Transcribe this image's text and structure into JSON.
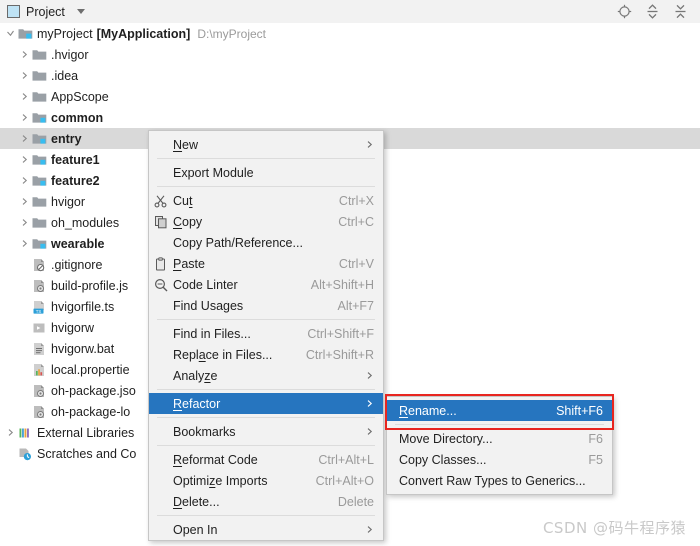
{
  "toolbar": {
    "title": "Project",
    "dropdown_icon": "chevron-down-icon",
    "actions": [
      {
        "name": "select-opened-file-icon",
        "label": "Select Opened File"
      },
      {
        "name": "expand-all-icon",
        "label": "Expand All"
      },
      {
        "name": "collapse-all-icon",
        "label": "Collapse All"
      }
    ]
  },
  "tree": {
    "root": {
      "name": "myProject",
      "module": "[MyApplication]",
      "path": "D:\\myProject",
      "icon": "project-folder-icon",
      "expanded": true
    },
    "items": [
      {
        "label": ".hvigor",
        "icon": "folder-icon",
        "arrow": true,
        "bold": false,
        "indent": 1
      },
      {
        "label": ".idea",
        "icon": "folder-icon",
        "arrow": true,
        "bold": false,
        "indent": 1
      },
      {
        "label": "AppScope",
        "icon": "folder-icon",
        "arrow": true,
        "bold": false,
        "indent": 1
      },
      {
        "label": "common",
        "icon": "module-folder-icon",
        "arrow": true,
        "bold": true,
        "indent": 1
      },
      {
        "label": "entry",
        "icon": "module-folder-icon",
        "arrow": true,
        "bold": true,
        "indent": 1,
        "selected": true
      },
      {
        "label": "feature1",
        "icon": "module-folder-icon",
        "arrow": true,
        "bold": true,
        "indent": 1
      },
      {
        "label": "feature2",
        "icon": "module-folder-icon",
        "arrow": true,
        "bold": true,
        "indent": 1
      },
      {
        "label": "hvigor",
        "icon": "folder-icon",
        "arrow": true,
        "bold": false,
        "indent": 1
      },
      {
        "label": "oh_modules",
        "icon": "folder-icon",
        "arrow": true,
        "bold": false,
        "indent": 1
      },
      {
        "label": "wearable",
        "icon": "module-folder-icon",
        "arrow": true,
        "bold": true,
        "indent": 1
      },
      {
        "label": ".gitignore",
        "icon": "gitignore-file-icon",
        "arrow": false,
        "bold": false,
        "indent": 1
      },
      {
        "label": "build-profile.js",
        "icon": "json-file-icon",
        "arrow": false,
        "bold": false,
        "indent": 1
      },
      {
        "label": "hvigorfile.ts",
        "icon": "ts-file-icon",
        "arrow": false,
        "bold": false,
        "indent": 1
      },
      {
        "label": "hvigorw",
        "icon": "script-file-icon",
        "arrow": false,
        "bold": false,
        "indent": 1
      },
      {
        "label": "hvigorw.bat",
        "icon": "bat-file-icon",
        "arrow": false,
        "bold": false,
        "indent": 1
      },
      {
        "label": "local.propertie",
        "icon": "properties-file-icon",
        "arrow": false,
        "bold": false,
        "indent": 1
      },
      {
        "label": "oh-package.jso",
        "icon": "json-file-icon",
        "arrow": false,
        "bold": false,
        "indent": 1
      },
      {
        "label": "oh-package-lo",
        "icon": "json-file-icon",
        "arrow": false,
        "bold": false,
        "indent": 1
      },
      {
        "label": "External Libraries",
        "icon": "libraries-icon",
        "arrow": true,
        "bold": false,
        "indent": 0
      },
      {
        "label": "Scratches and Co",
        "icon": "scratches-icon",
        "arrow": false,
        "bold": false,
        "indent": 0
      }
    ]
  },
  "context_menu": {
    "items": [
      {
        "label": "New",
        "mnemonic": "N",
        "shortcut": "",
        "icon": "",
        "submenu": true
      },
      {
        "separator": true
      },
      {
        "label": "Export Module",
        "mnemonic": "",
        "shortcut": "",
        "icon": "",
        "submenu": false
      },
      {
        "separator": true
      },
      {
        "label": "Cut",
        "mnemonic": "t",
        "shortcut": "Ctrl+X",
        "icon": "scissors-icon",
        "submenu": false
      },
      {
        "label": "Copy",
        "mnemonic": "C",
        "shortcut": "Ctrl+C",
        "icon": "copy-icon",
        "submenu": false
      },
      {
        "label": "Copy Path/Reference...",
        "mnemonic": "",
        "shortcut": "",
        "icon": "",
        "submenu": false
      },
      {
        "label": "Paste",
        "mnemonic": "P",
        "shortcut": "Ctrl+V",
        "icon": "clipboard-icon",
        "submenu": false
      },
      {
        "label": "Code Linter",
        "mnemonic": "",
        "shortcut": "Alt+Shift+H",
        "icon": "linter-icon",
        "submenu": false
      },
      {
        "label": "Find Usages",
        "mnemonic": "",
        "shortcut": "Alt+F7",
        "icon": "",
        "submenu": false
      },
      {
        "separator": true
      },
      {
        "label": "Find in Files...",
        "mnemonic": "",
        "shortcut": "Ctrl+Shift+F",
        "icon": "",
        "submenu": false
      },
      {
        "label": "Replace in Files...",
        "mnemonic": "a",
        "shortcut": "Ctrl+Shift+R",
        "icon": "",
        "submenu": false
      },
      {
        "label": "Analyze",
        "mnemonic": "z",
        "shortcut": "",
        "icon": "",
        "submenu": true
      },
      {
        "separator": true
      },
      {
        "label": "Refactor",
        "mnemonic": "R",
        "shortcut": "",
        "icon": "",
        "submenu": true,
        "highlighted": true
      },
      {
        "separator": true
      },
      {
        "label": "Bookmarks",
        "mnemonic": "",
        "shortcut": "",
        "icon": "",
        "submenu": true
      },
      {
        "separator": true
      },
      {
        "label": "Reformat Code",
        "mnemonic": "R",
        "shortcut": "Ctrl+Alt+L",
        "icon": "",
        "submenu": false
      },
      {
        "label": "Optimize Imports",
        "mnemonic": "z",
        "shortcut": "Ctrl+Alt+O",
        "icon": "",
        "submenu": false
      },
      {
        "label": "Delete...",
        "mnemonic": "D",
        "shortcut": "Delete",
        "icon": "",
        "submenu": false
      },
      {
        "separator": true
      },
      {
        "label": "Open In",
        "mnemonic": "",
        "shortcut": "",
        "icon": "",
        "submenu": true
      }
    ]
  },
  "submenu": {
    "items": [
      {
        "label": "Rename...",
        "mnemonic": "R",
        "shortcut": "Shift+F6",
        "highlighted": true
      },
      {
        "separator": true
      },
      {
        "label": "Move Directory...",
        "mnemonic": "",
        "shortcut": "F6"
      },
      {
        "label": "Copy Classes...",
        "mnemonic": "",
        "shortcut": "F5"
      },
      {
        "label": "Convert Raw Types to Generics...",
        "mnemonic": "",
        "shortcut": ""
      }
    ]
  },
  "annotation": {
    "highlight_color": "#e8251f",
    "selection_color": "#2675bf"
  },
  "watermark": {
    "text": "CSDN @码牛程序猿"
  }
}
